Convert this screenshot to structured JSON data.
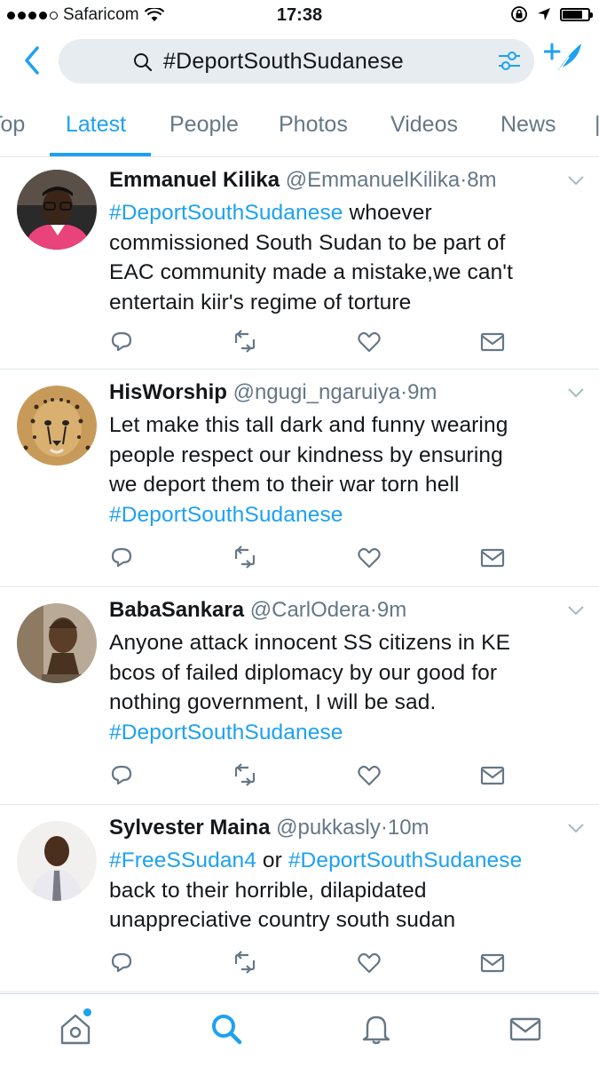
{
  "status_bar": {
    "carrier": "Safaricom",
    "time": "17:38",
    "battery_level": 0.8
  },
  "search": {
    "query": "#DeportSouthSudanese"
  },
  "tabs": [
    {
      "label": "Top",
      "active": false
    },
    {
      "label": "Latest",
      "active": true
    },
    {
      "label": "People",
      "active": false
    },
    {
      "label": "Photos",
      "active": false
    },
    {
      "label": "Videos",
      "active": false
    },
    {
      "label": "News",
      "active": false
    }
  ],
  "tweets": [
    {
      "name": "Emmanuel Kilika",
      "handle": "@EmmanuelKilika",
      "sep": "·",
      "time": "8m",
      "lines": [
        [
          {
            "t": "#DeportSouthSudanese",
            "tag": true
          },
          {
            "t": " whoever",
            "tag": false
          }
        ],
        [
          {
            "t": "commissioned South Sudan to be part of",
            "tag": false
          }
        ],
        [
          {
            "t": "EAC community made a mistake,we can't",
            "tag": false
          }
        ],
        [
          {
            "t": "entertain kiir's regime of torture",
            "tag": false
          }
        ]
      ]
    },
    {
      "name": "HisWorship",
      "handle": "@ngugi_ngaruiya",
      "sep": "·",
      "time": "9m",
      "lines": [
        [
          {
            "t": "Let make this tall dark and funny wearing",
            "tag": false
          }
        ],
        [
          {
            "t": "people respect our kindness by ensuring",
            "tag": false
          }
        ],
        [
          {
            "t": "we deport them to their war torn hell",
            "tag": false
          }
        ],
        [
          {
            "t": "#DeportSouthSudanese",
            "tag": true
          }
        ]
      ]
    },
    {
      "name": "BabaSankara",
      "handle": "@CarlOdera",
      "sep": "·",
      "time": "9m",
      "lines": [
        [
          {
            "t": "Anyone attack innocent SS citizens in KE",
            "tag": false
          }
        ],
        [
          {
            "t": "bcos of failed diplomacy by our good for",
            "tag": false
          }
        ],
        [
          {
            "t": "nothing government, I will be sad.",
            "tag": false
          }
        ],
        [
          {
            "t": "#DeportSouthSudanese",
            "tag": true
          }
        ]
      ]
    },
    {
      "name": "Sylvester Maina",
      "handle": "@pukkasly",
      "sep": "·",
      "time": "10m",
      "lines": [
        [
          {
            "t": "#FreeSSudan4",
            "tag": true
          },
          {
            "t": " or ",
            "tag": false
          },
          {
            "t": "#DeportSouthSudanese",
            "tag": true
          }
        ],
        [
          {
            "t": "back to their horrible, dilapidated",
            "tag": false
          }
        ],
        [
          {
            "t": "unappreciative country south sudan",
            "tag": false
          }
        ]
      ]
    }
  ],
  "colors": {
    "accent": "#1da1f2",
    "secondary_text": "#657786",
    "search_bg": "#e6ecf0"
  }
}
